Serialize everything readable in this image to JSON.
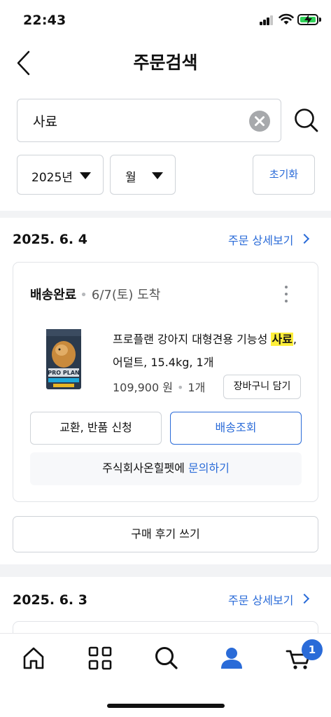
{
  "status_bar": {
    "time": "22:43"
  },
  "header": {
    "title": "주문검색"
  },
  "search": {
    "value": "사료",
    "placeholder": ""
  },
  "filters": {
    "year_label": "2025년",
    "month_label": "월",
    "reset_label": "초기화"
  },
  "orders": [
    {
      "date": "2025. 6. 4",
      "detail_label": "주문 상세보기",
      "delivery_status": "배송완료",
      "delivery_eta": "6/7(토) 도착",
      "product_name_prefix": "프로플랜 강아지 대형견용 기능성 ",
      "product_name_highlight": "사료",
      "product_name_suffix": ",",
      "product_name_line2": "어덜트, 15.4kg, 1개",
      "product_image_text": "PRO PLAN",
      "price": "109,900 원",
      "quantity": "1개",
      "add_to_cart_label": "장바구니 담기",
      "exchange_label": "교환, 반품 신청",
      "track_label": "배송조회",
      "seller_name": "주식회사온힐펫에",
      "inquiry_label": "문의하기",
      "review_label": "구매 후기 쓰기"
    },
    {
      "date": "2025. 6. 3",
      "detail_label": "주문 상세보기"
    }
  ],
  "bottom_nav": {
    "items": [
      "home-icon",
      "category-grid-icon",
      "search-icon",
      "my-page-icon",
      "cart-icon"
    ],
    "active": "my-page-icon",
    "cart_badge": "1"
  },
  "colors": {
    "accent": "#2a6bd8",
    "highlight": "#ffef3a",
    "divider": "#f2f3f5"
  }
}
